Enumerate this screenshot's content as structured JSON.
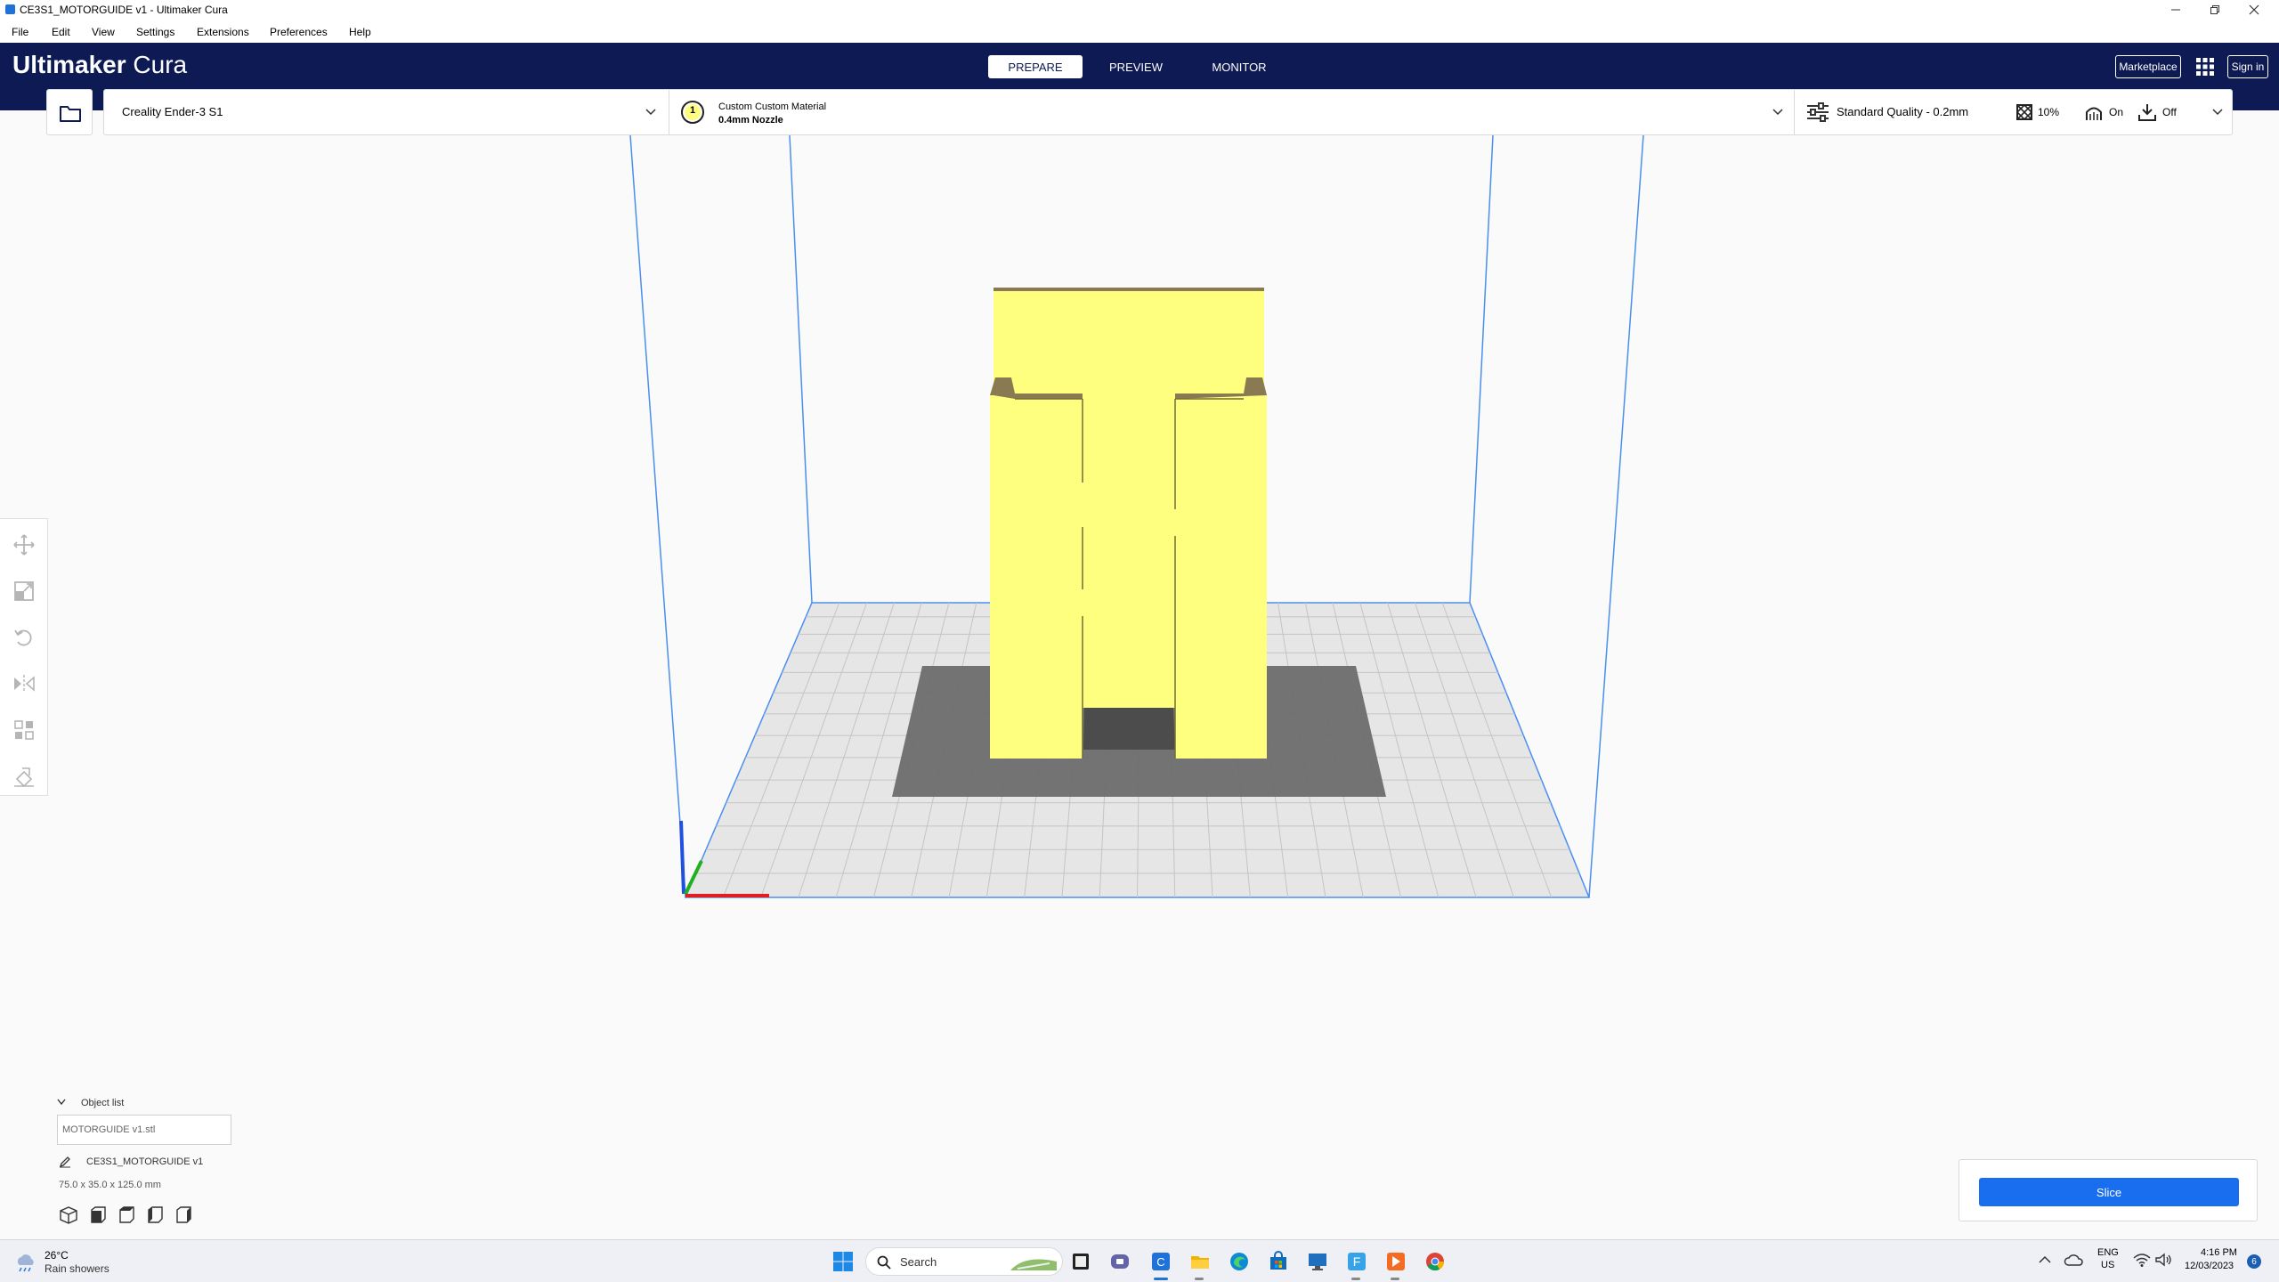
{
  "window": {
    "title": "CE3S1_MOTORGUIDE v1 - Ultimaker Cura"
  },
  "menu": [
    "File",
    "Edit",
    "View",
    "Settings",
    "Extensions",
    "Preferences",
    "Help"
  ],
  "header": {
    "logo_bold": "Ultimaker",
    "logo_light": "Cura",
    "tabs": [
      {
        "label": "PREPARE",
        "active": true
      },
      {
        "label": "PREVIEW",
        "active": false
      },
      {
        "label": "MONITOR",
        "active": false
      }
    ],
    "marketplace_label": "Marketplace",
    "signin_label": "Sign in"
  },
  "toolbar": {
    "printer": "Creality Ender-3 S1",
    "extruder_number": "1",
    "material": "Custom Custom Material",
    "nozzle": "0.4mm Nozzle",
    "quality": "Standard Quality - 0.2mm",
    "infill": "10%",
    "support": "On",
    "adhesion": "Off"
  },
  "tools": [
    "move-icon",
    "scale-icon",
    "rotate-icon",
    "mirror-icon",
    "per-model-settings-icon",
    "support-blocker-icon"
  ],
  "object_list": {
    "header": "Object list",
    "item": "MOTORGUIDE v1.stl",
    "job_name": "CE3S1_MOTORGUIDE v1",
    "dimensions": "75.0 x 35.0 x 125.0 mm"
  },
  "slice_label": "Slice",
  "taskbar": {
    "temperature": "26°C",
    "weather": "Rain showers",
    "search_label": "Search",
    "lang_top": "ENG",
    "lang_bottom": "US",
    "time": "4:16 PM",
    "date": "12/03/2023",
    "notifications": "6"
  },
  "colors": {
    "header": "#0d1a53",
    "accent": "#196ef0",
    "model": "#ffff7f",
    "axis_x": "#e02020",
    "axis_y": "#20b020",
    "axis_z": "#2050e0"
  }
}
